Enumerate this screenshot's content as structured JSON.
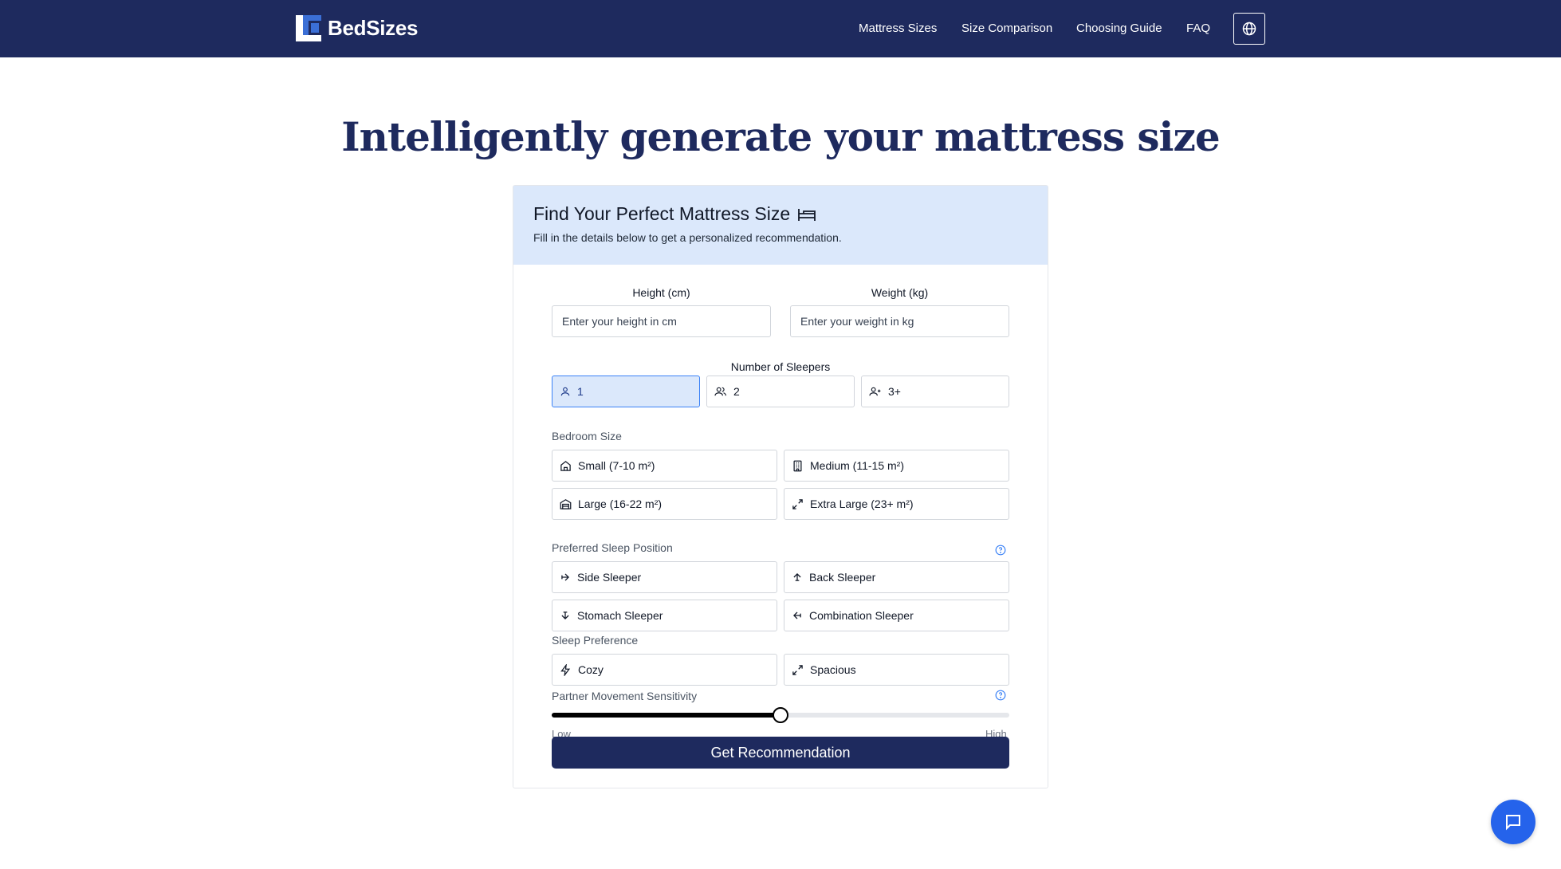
{
  "brand": {
    "name": "BedSizes"
  },
  "nav": {
    "links": [
      "Mattress Sizes",
      "Size Comparison",
      "Choosing Guide",
      "FAQ"
    ],
    "language_icon": "globe-icon"
  },
  "hero": {
    "title": "Intelligently generate your mattress size"
  },
  "form": {
    "title": "Find Your Perfect Mattress Size",
    "title_icon": "bed-icon",
    "subtitle": "Fill in the details below to get a personalized recommendation.",
    "height": {
      "label": "Height (cm)",
      "placeholder": "Enter your height in cm",
      "value": ""
    },
    "weight": {
      "label": "Weight (kg)",
      "placeholder": "Enter your weight in kg",
      "value": ""
    },
    "sleepers": {
      "label": "Number of Sleepers",
      "options": [
        "1",
        "2",
        "3+"
      ],
      "selected": "1"
    },
    "bedroom": {
      "label": "Bedroom Size",
      "options": [
        "Small (7-10 m²)",
        "Medium (11-15 m²)",
        "Large (16-22 m²)",
        "Extra Large (23+ m²)"
      ]
    },
    "position": {
      "label": "Preferred Sleep Position",
      "options": [
        "Side Sleeper",
        "Back Sleeper",
        "Stomach Sleeper",
        "Combination Sleeper"
      ]
    },
    "preference": {
      "label": "Sleep Preference",
      "options": [
        "Cozy",
        "Spacious"
      ]
    },
    "sensitivity": {
      "label": "Partner Movement Sensitivity",
      "min_label": "Low",
      "max_label": "High",
      "value_fraction": 0.5
    },
    "submit_label": "Get Recommendation"
  },
  "colors": {
    "navy": "#1e2a5e",
    "accent_blue": "#2563eb",
    "light_blue": "#dbe8fb"
  }
}
